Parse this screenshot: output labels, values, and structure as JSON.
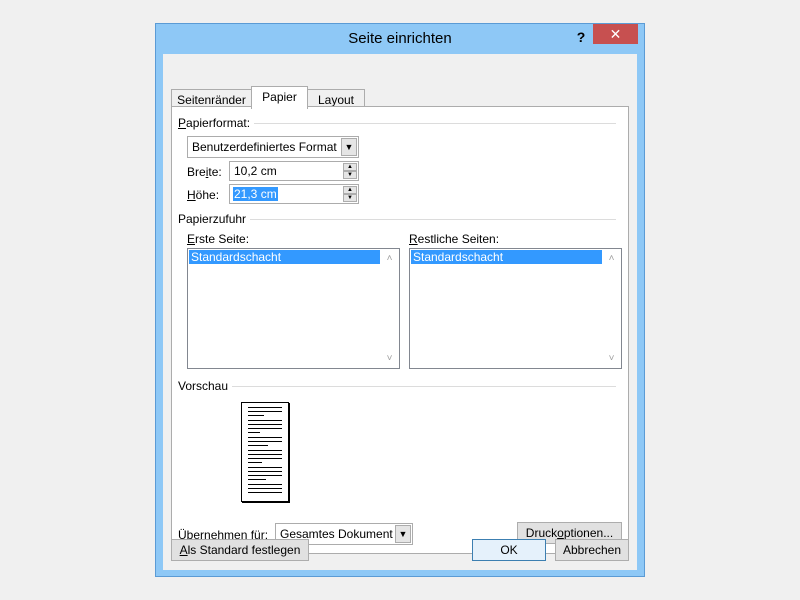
{
  "window": {
    "title": "Seite einrichten",
    "help": "?",
    "close": "✕"
  },
  "tabs": [
    {
      "label": "Seitenränder"
    },
    {
      "label": "Papier"
    },
    {
      "label": "Layout"
    }
  ],
  "paper_format": {
    "group_label": "Papierformat:",
    "group_label_u": "P",
    "group_label_rest": "apierformat:",
    "format_value": "Benutzerdefiniertes Format",
    "width_label_pre": "Bre",
    "width_label_u": "i",
    "width_label_post": "te:",
    "width_value": "10,2 cm",
    "height_label_u": "H",
    "height_label_rest": "öhe:",
    "height_value": "21,3 cm"
  },
  "paper_source": {
    "group_label": "Papierzufuhr",
    "first_page_label_u": "E",
    "first_page_label_rest": "rste Seite:",
    "first_page_selected": "Standardschacht",
    "other_pages_label_u": "R",
    "other_pages_label_rest": "estliche Seiten:",
    "other_pages_selected": "Standardschacht"
  },
  "preview": {
    "group_label": "Vorschau"
  },
  "apply_to": {
    "label_u": "Ü",
    "label_rest": "bernehmen für:",
    "value": "Gesamtes Dokument"
  },
  "buttons": {
    "print_options_pre": "Druck",
    "print_options_u": "o",
    "print_options_post": "ptionen...",
    "set_default_u": "A",
    "set_default_rest": "ls Standard festlegen",
    "ok": "OK",
    "cancel": "Abbrechen"
  },
  "icons": {
    "dropdown": "chevron-down-icon",
    "spin_up": "arrow-up-icon",
    "spin_down": "arrow-down-icon",
    "scroll_up": "chevron-up-icon",
    "scroll_down": "chevron-down-icon"
  },
  "colors": {
    "title_bar": "#8ec8f6",
    "close_button": "#c75050",
    "selection": "#3399ff",
    "default_button": "#3c7fb1"
  }
}
